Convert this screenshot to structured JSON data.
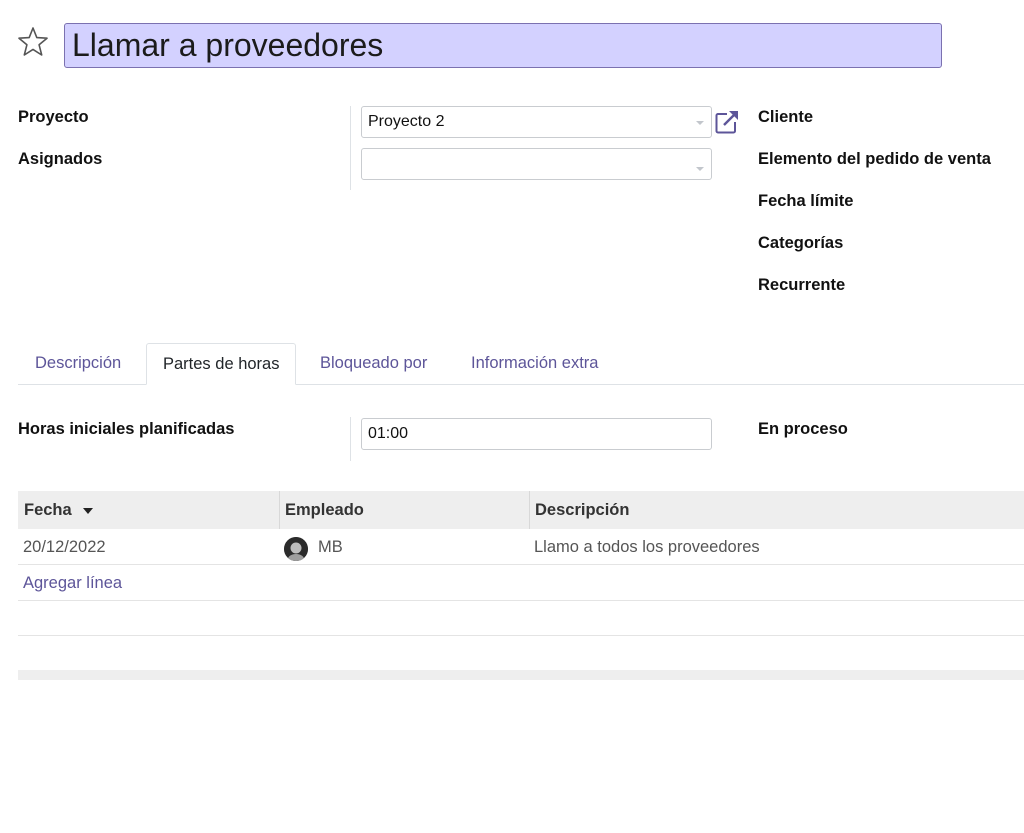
{
  "task": {
    "title": "Llamar a proveedores"
  },
  "left_fields": {
    "project": {
      "label": "Proyecto",
      "value": "Proyecto 2"
    },
    "assignees": {
      "label": "Asignados",
      "value": ""
    }
  },
  "right_fields": [
    "Cliente",
    "Elemento del pedido de venta",
    "Fecha límite",
    "Categorías",
    "Recurrente"
  ],
  "tabs": [
    {
      "label": "Descripción",
      "active": false
    },
    {
      "label": "Partes de horas",
      "active": true
    },
    {
      "label": "Bloqueado por",
      "active": false
    },
    {
      "label": "Información extra",
      "active": false
    }
  ],
  "timesheet": {
    "planned_hours": {
      "label": "Horas iniciales planificadas",
      "value": "01:00"
    },
    "status": "En proceso",
    "columns": [
      "Fecha",
      "Empleado",
      "Descripción"
    ],
    "rows": [
      {
        "date": "20/12/2022",
        "employee": "MB",
        "description": "Llamo a todos los proveedores"
      }
    ],
    "add_line": "Agregar línea"
  },
  "colors": {
    "title_bg": "#d3d1ff",
    "accent": "#5d5599",
    "table_header_bg": "#eeeeee"
  }
}
